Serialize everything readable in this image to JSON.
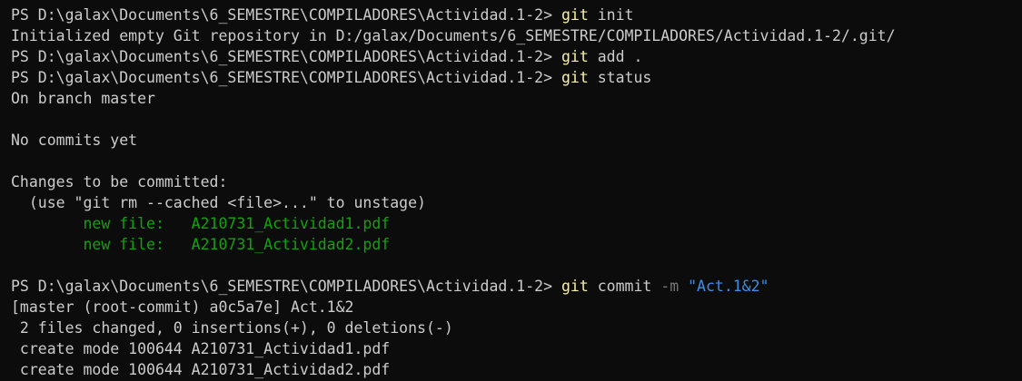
{
  "terminal": {
    "prompt": "PS D:\\galax\\Documents\\6_SEMESTRE\\COMPILADORES\\Actividad.1-2> ",
    "cmd1": {
      "git": "git",
      "rest": " init"
    },
    "out_init": "Initialized empty Git repository in D:/galax/Documents/6_SEMESTRE/COMPILADORES/Actividad.1-2/.git/",
    "cmd2": {
      "git": "git",
      "rest": " add ."
    },
    "cmd3": {
      "git": "git",
      "rest": " status"
    },
    "status": {
      "branch": "On branch master",
      "no_commits": "No commits yet",
      "changes_header": "Changes to be committed:",
      "hint": "  (use \"git rm --cached <file>...\" to unstage)",
      "files": [
        "        new file:   A210731_Actividad1.pdf",
        "        new file:   A210731_Actividad2.pdf"
      ]
    },
    "cmd4": {
      "git": "git",
      "rest": " commit ",
      "flag": "-m",
      "space": " ",
      "message": "\"Act.1&2\""
    },
    "commit_out": [
      "[master (root-commit) a0c5a7e] Act.1&2",
      " 2 files changed, 0 insertions(+), 0 deletions(-)",
      " create mode 100644 A210731_Actividad1.pdf",
      " create mode 100644 A210731_Actividad2.pdf"
    ],
    "colors": {
      "background": "#0c0c0c",
      "text": "#cccccc",
      "git_command": "#f9f1a5",
      "staged_file": "#13a10e",
      "string_arg": "#3b8eea",
      "flag": "#767676"
    }
  }
}
